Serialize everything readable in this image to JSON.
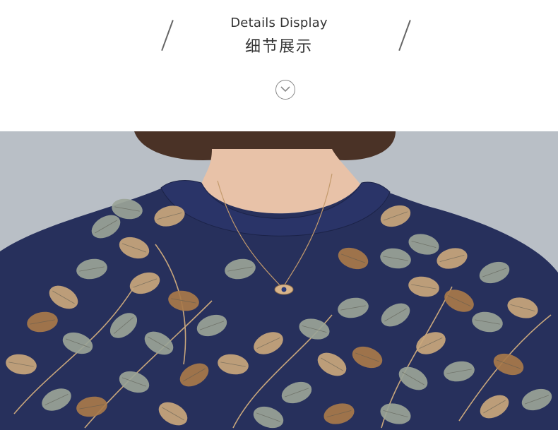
{
  "header": {
    "title_en": "Details Display",
    "title_zh": "细节展示"
  },
  "icons": {
    "scroll": "chevron-down-circle-icon"
  },
  "photo": {
    "subject": "product-detail-photo",
    "colors": {
      "background": "#b9bfc6",
      "fabric": "#27305c",
      "leaf_grey": "#9aa497",
      "leaf_tan": "#c9a77c",
      "leaf_brown": "#a8794a",
      "skin": "#e8c2a8",
      "hair": "#4a3226"
    }
  }
}
